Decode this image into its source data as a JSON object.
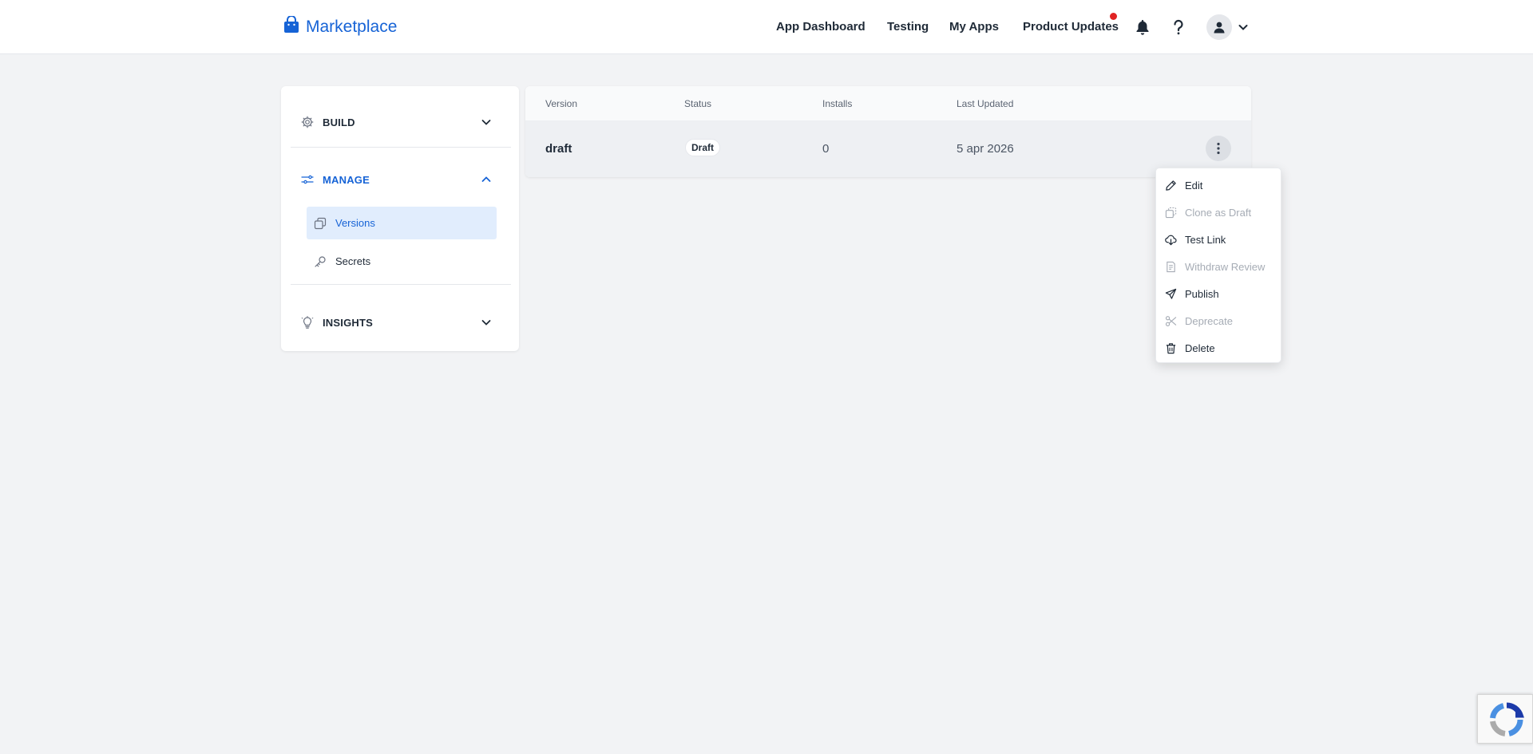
{
  "colors": {
    "accent": "#1663d6",
    "active_bg": "#e1edfd",
    "notification_dot": "#e02424",
    "disabled_text": "#a6acb5",
    "page_bg": "#f2f3f5"
  },
  "header": {
    "brand": {
      "icon": "shopping-bag-icon",
      "label": "Marketplace"
    },
    "nav": [
      {
        "label": "App Dashboard"
      },
      {
        "label": "Testing"
      },
      {
        "label": "My Apps"
      },
      {
        "label": "Product Updates",
        "has_notification": true
      }
    ],
    "icons": [
      "bell-icon",
      "help-icon",
      "user-avatar-icon",
      "chevron-down-icon"
    ]
  },
  "sidebar": {
    "sections": [
      {
        "label": "BUILD",
        "icon": "gear-icon",
        "expanded": false
      },
      {
        "label": "MANAGE",
        "icon": "sliders-icon",
        "expanded": true,
        "items": [
          {
            "label": "Versions",
            "icon": "copy-icon",
            "active": true
          },
          {
            "label": "Secrets",
            "icon": "key-icon",
            "active": false
          }
        ]
      },
      {
        "label": "INSIGHTS",
        "icon": "lightbulb-icon",
        "expanded": false
      }
    ]
  },
  "table": {
    "columns": [
      "Version",
      "Status",
      "Installs",
      "Last Updated"
    ],
    "rows": [
      {
        "version": "draft",
        "status": "Draft",
        "installs": "0",
        "last_updated": "5 apr 2026"
      }
    ]
  },
  "row_menu": {
    "items": [
      {
        "label": "Edit",
        "icon": "pencil-icon",
        "disabled": false
      },
      {
        "label": "Clone as Draft",
        "icon": "clone-icon",
        "disabled": true
      },
      {
        "label": "Test Link",
        "icon": "cloud-download-icon",
        "disabled": false
      },
      {
        "label": "Withdraw Review",
        "icon": "document-icon",
        "disabled": true
      },
      {
        "label": "Publish",
        "icon": "send-icon",
        "disabled": false
      },
      {
        "label": "Deprecate",
        "icon": "scissors-icon",
        "disabled": true
      },
      {
        "label": "Delete",
        "icon": "trash-icon",
        "disabled": false
      }
    ]
  }
}
